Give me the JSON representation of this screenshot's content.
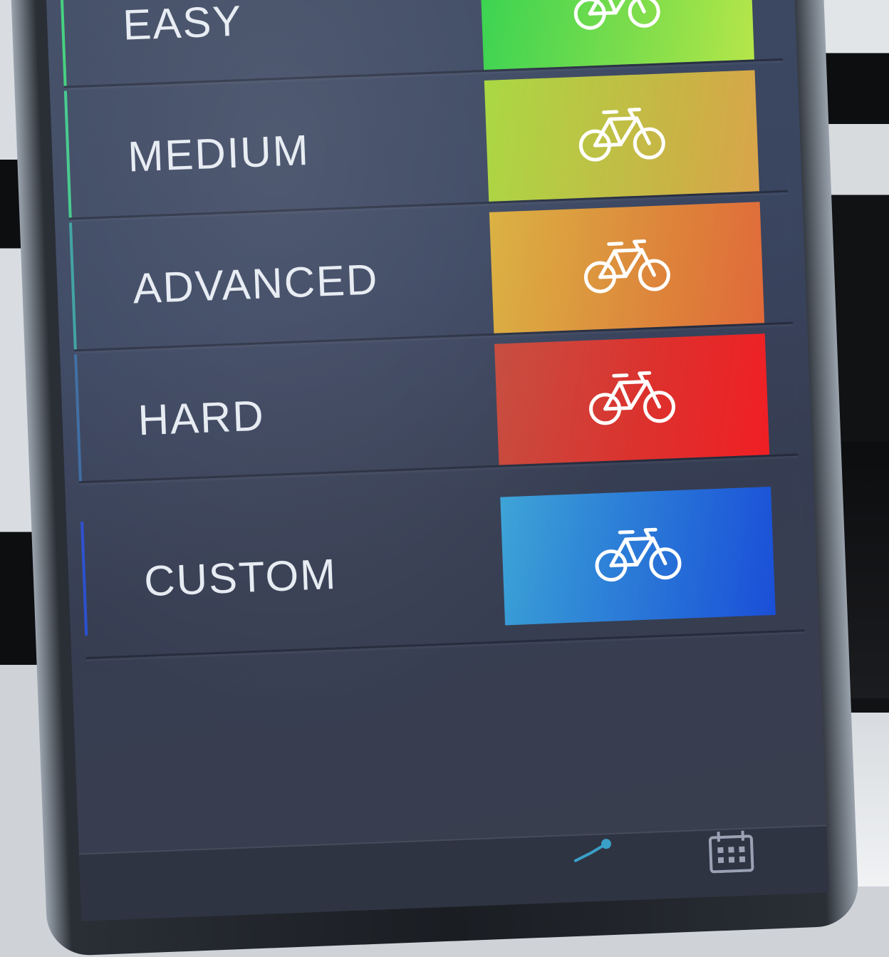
{
  "levels": [
    {
      "label": "EASY",
      "icon": "bicycle-icon",
      "gradient_from": "#2fd14a",
      "gradient_to": "#b6e64a",
      "accent": "#3fcf7a"
    },
    {
      "label": "MEDIUM",
      "icon": "bicycle-icon",
      "gradient_from": "#a6d63a",
      "gradient_to": "#d9a44a",
      "accent": "#3fc98a"
    },
    {
      "label": "ADVANCED",
      "icon": "bicycle-icon",
      "gradient_from": "#d9ae3a",
      "gradient_to": "#e06a3a",
      "accent": "#3aa0a0"
    },
    {
      "label": "HARD",
      "icon": "bicycle-icon",
      "gradient_from": "#c4483a",
      "gradient_to": "#f01f24",
      "accent": "#3a6aa0"
    },
    {
      "label": "CUSTOM",
      "icon": "bicycle-icon",
      "gradient_from": "#3aa2d6",
      "gradient_to": "#1a4fd8",
      "accent": "#2a4fd0"
    }
  ],
  "bottom_nav": {
    "items": [
      {
        "icon": "route-icon"
      },
      {
        "icon": "calendar-icon"
      }
    ]
  }
}
